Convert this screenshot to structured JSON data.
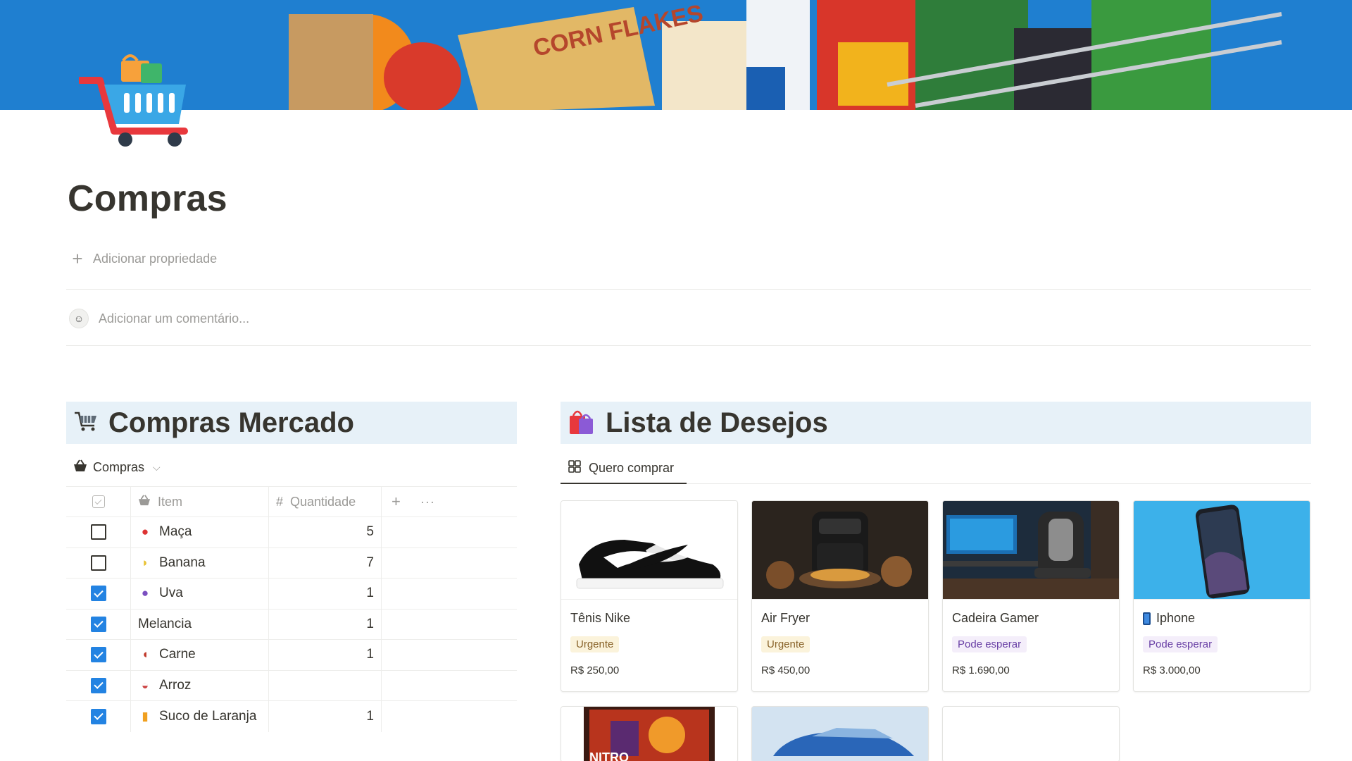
{
  "page": {
    "title": "Compras",
    "add_property": "Adicionar propriedade",
    "comment_placeholder": "Adicionar um comentário..."
  },
  "market": {
    "heading": "Compras Mercado",
    "view_label": "Compras",
    "columns": {
      "item": "Item",
      "quantity": "Quantidade"
    },
    "rows": [
      {
        "item": "Maça",
        "qty": "5",
        "checked": false,
        "icon": "apple-icon"
      },
      {
        "item": "Banana",
        "qty": "7",
        "checked": false,
        "icon": "banana-icon"
      },
      {
        "item": "Uva",
        "qty": "1",
        "checked": true,
        "icon": "grapes-icon"
      },
      {
        "item": "Melancia",
        "qty": "1",
        "checked": true,
        "icon": ""
      },
      {
        "item": "Carne",
        "qty": "1",
        "checked": true,
        "icon": "meat-icon"
      },
      {
        "item": "Arroz",
        "qty": "",
        "checked": true,
        "icon": "rice-icon"
      },
      {
        "item": "Suco de Laranja",
        "qty": "1",
        "checked": true,
        "icon": "juice-icon"
      }
    ]
  },
  "wishlist": {
    "heading": "Lista de Desejos",
    "view_label": "Quero comprar",
    "cards": [
      {
        "name": "Tênis Nike",
        "tag": "Urgente",
        "price": "R$ 250,00"
      },
      {
        "name": "Air Fryer",
        "tag": "Urgente",
        "price": "R$ 450,00"
      },
      {
        "name": "Cadeira Gamer",
        "tag": "Pode esperar",
        "price": "R$ 1.690,00"
      },
      {
        "name": "Iphone",
        "tag": "Pode esperar",
        "price": "R$ 3.000,00"
      }
    ],
    "extra_cards": [
      {
        "image_text": "NITRO"
      }
    ]
  },
  "colors": {
    "accent": "#2383e2",
    "section_header_bg": "#e7f1f8",
    "tag_urgent_bg": "#fbf3db",
    "tag_wait_bg": "#f4eefa"
  }
}
